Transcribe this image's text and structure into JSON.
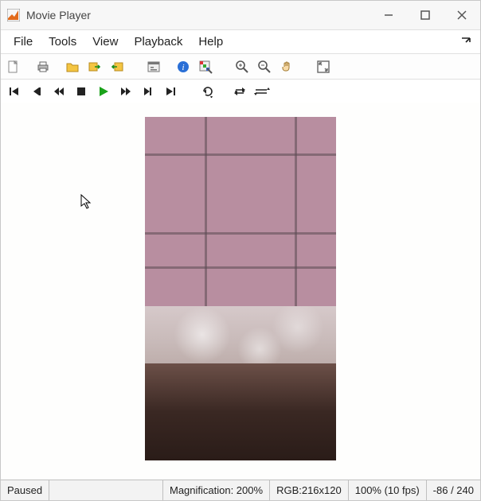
{
  "window": {
    "title": "Movie Player"
  },
  "menus": {
    "file": "File",
    "tools": "Tools",
    "view": "View",
    "playback": "Playback",
    "help": "Help"
  },
  "icons": {
    "app": "matlab-app-icon",
    "min": "minimize-icon",
    "max": "maximize-icon",
    "close": "close-icon",
    "new": "new-file-icon",
    "print": "print-icon",
    "open": "open-folder-icon",
    "export": "export-workspace-icon",
    "import": "import-workspace-icon",
    "video_info": "video-info-icon",
    "info": "info-icon",
    "px_region": "pixel-region-icon",
    "zoom_in": "zoom-in-icon",
    "zoom_out": "zoom-out-icon",
    "pan": "pan-hand-icon",
    "fit": "fit-window-icon",
    "first": "go-first-icon",
    "step_back": "step-back-icon",
    "rewind": "rewind-icon",
    "stop": "stop-icon",
    "play": "play-icon",
    "ff": "fast-forward-icon",
    "step_fwd": "step-forward-icon",
    "last": "go-last-icon",
    "jump": "jump-to-icon",
    "repeat": "repeat-icon",
    "abrepeat": "ab-repeat-icon",
    "dock": "dock-icon"
  },
  "status": {
    "state": "Paused",
    "magnification": "Magnification: 200%",
    "format": "RGB:216x120",
    "rate": "100% (10 fps)",
    "frame": "-86 / 240"
  },
  "colors": {
    "accent_play": "#1aa21a"
  }
}
